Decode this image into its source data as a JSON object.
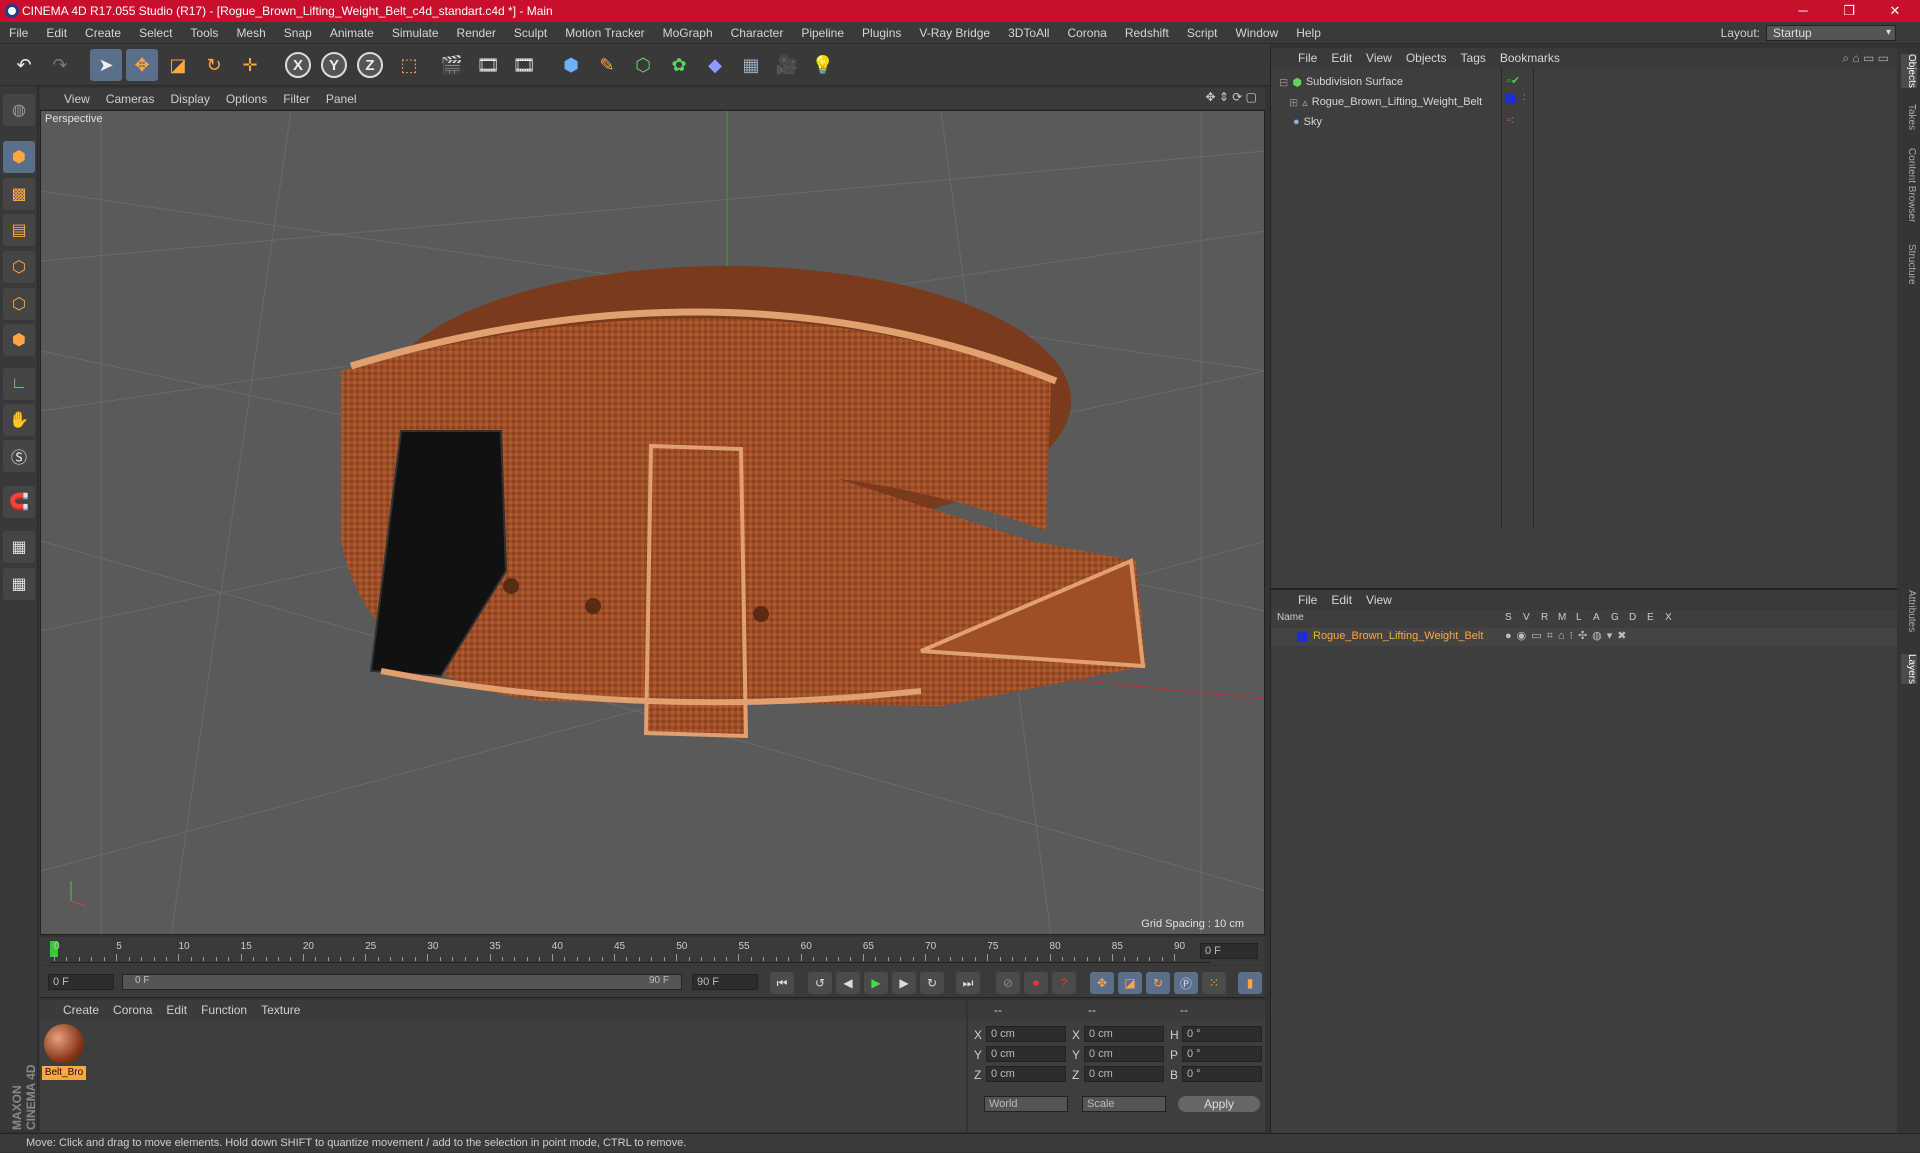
{
  "window": {
    "title": "CINEMA 4D R17.055 Studio (R17) - [Rogue_Brown_Lifting_Weight_Belt_c4d_standart.c4d *] - Main",
    "minimize": "─",
    "restore": "❐",
    "close": "✕"
  },
  "menu": [
    "File",
    "Edit",
    "Create",
    "Select",
    "Tools",
    "Mesh",
    "Snap",
    "Animate",
    "Simulate",
    "Render",
    "Sculpt",
    "Motion Tracker",
    "MoGraph",
    "Character",
    "Pipeline",
    "Plugins",
    "V-Ray Bridge",
    "3DToAll",
    "Corona",
    "Redshift",
    "Script",
    "Window",
    "Help"
  ],
  "layout": {
    "label": "Layout:",
    "value": "Startup"
  },
  "viewport": {
    "menu": [
      "View",
      "Cameras",
      "Display",
      "Options",
      "Filter",
      "Panel"
    ],
    "label": "Perspective",
    "grid_spacing": "Grid Spacing : 10 cm"
  },
  "timeline": {
    "ticks": [
      "0",
      "5",
      "10",
      "15",
      "20",
      "25",
      "30",
      "35",
      "40",
      "45",
      "50",
      "55",
      "60",
      "65",
      "70",
      "75",
      "80",
      "85",
      "90"
    ],
    "current_frame": "0 F",
    "start": "0 F",
    "range_start": "0 F",
    "range_end": "90 F",
    "end": "90 F"
  },
  "material_manager": {
    "menu": [
      "Create",
      "Corona",
      "Edit",
      "Function",
      "Texture"
    ],
    "material_name": "Belt_Bro"
  },
  "coordinates": {
    "header": [
      "--",
      "--",
      "--"
    ],
    "rows": [
      {
        "a": "X",
        "av": "0 cm",
        "b": "X",
        "bv": "0 cm",
        "c": "H",
        "cv": "0 °"
      },
      {
        "a": "Y",
        "av": "0 cm",
        "b": "Y",
        "bv": "0 cm",
        "c": "P",
        "cv": "0 °"
      },
      {
        "a": "Z",
        "av": "0 cm",
        "b": "Z",
        "bv": "0 cm",
        "c": "B",
        "cv": "0 °"
      }
    ],
    "mode1": "World",
    "mode2": "Scale",
    "apply": "Apply"
  },
  "object_manager": {
    "menu": [
      "File",
      "Edit",
      "View",
      "Objects",
      "Tags",
      "Bookmarks"
    ],
    "objects": [
      {
        "name": "Subdivision Surface"
      },
      {
        "name": "Rogue_Brown_Lifting_Weight_Belt"
      },
      {
        "name": "Sky"
      }
    ]
  },
  "layer_manager": {
    "menu": [
      "File",
      "Edit",
      "View"
    ],
    "columns": [
      "Name",
      "S",
      "V",
      "R",
      "M",
      "L",
      "A",
      "G",
      "D",
      "E",
      "X"
    ],
    "layer_name": "Rogue_Brown_Lifting_Weight_Belt"
  },
  "side_tabs": [
    "Objects",
    "Takes",
    "Content Browser",
    "Structure",
    "Attributes",
    "Layers"
  ],
  "status": "Move: Click and drag to move elements. Hold down SHIFT to quantize movement / add to the selection in point mode, CTRL to remove.",
  "brand": "MAXON CINEMA 4D",
  "colors": {
    "title_bar": "#c8102e",
    "selection_orange": "#ffa640",
    "belt_brown": "#a2512a"
  }
}
